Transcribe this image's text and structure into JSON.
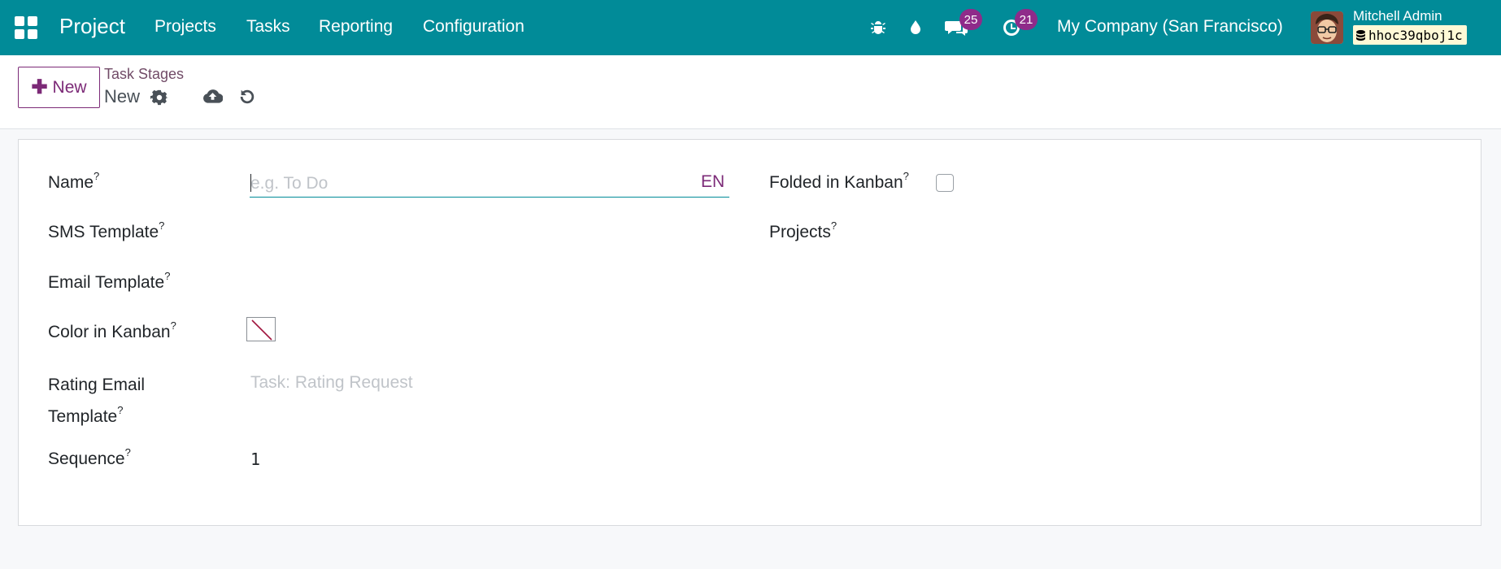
{
  "navbar": {
    "app_title": "Project",
    "menu": [
      "Projects",
      "Tasks",
      "Reporting",
      "Configuration"
    ],
    "icons": [
      "bug-icon",
      "droplet-icon",
      "chat-icon",
      "clock-icon"
    ],
    "messages_count": "25",
    "activities_count": "21",
    "company": "My Company (San Francisco)",
    "user_name": "Mitchell Admin",
    "database": "hhoc39qboj1c"
  },
  "control_panel": {
    "new_button": "New",
    "breadcrumb_parent": "Task Stages",
    "breadcrumb_current": "New",
    "icons": [
      "gear-icon",
      "cloud-upload-icon",
      "undo-icon"
    ]
  },
  "form": {
    "name_label": "Name",
    "name_placeholder": "e.g. To Do",
    "name_value": "",
    "lang": "EN",
    "folded_label": "Folded in Kanban",
    "folded_checked": false,
    "sms_label": "SMS Template",
    "projects_label": "Projects",
    "email_label": "Email Template",
    "color_label": "Color in Kanban",
    "rating_label_line1": "Rating Email",
    "rating_label_line2": "Template",
    "rating_placeholder": "Task: Rating Request",
    "sequence_label": "Sequence",
    "sequence_value": "1",
    "help_mark": "?"
  },
  "colors": {
    "navbar": "#018b98",
    "accent": "#7c2a77",
    "badge": "#8f2b8a"
  }
}
